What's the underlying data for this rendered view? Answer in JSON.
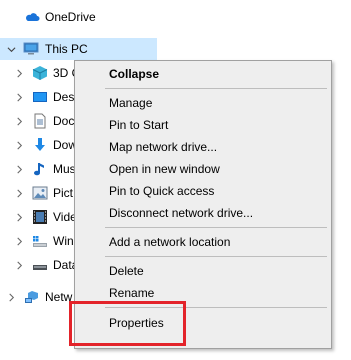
{
  "tree": {
    "items": [
      {
        "label": "OneDrive",
        "icon": "onedrive-cloud-icon"
      },
      {
        "label": "This PC",
        "icon": "computer-icon"
      },
      {
        "label": "3D O",
        "icon": "3d-objects-icon"
      },
      {
        "label": "Des",
        "icon": "desktop-icon"
      },
      {
        "label": "Doc",
        "icon": "documents-icon"
      },
      {
        "label": "Dow",
        "icon": "downloads-icon"
      },
      {
        "label": "Mus",
        "icon": "music-icon"
      },
      {
        "label": "Pict",
        "icon": "pictures-icon"
      },
      {
        "label": "Vide",
        "icon": "videos-icon"
      },
      {
        "label": "Win",
        "icon": "windows-drive-icon"
      },
      {
        "label": "Data",
        "icon": "data-drive-icon"
      },
      {
        "label": "Netw",
        "icon": "network-icon"
      }
    ]
  },
  "context_menu": {
    "items": [
      {
        "label": "Collapse",
        "bold": true
      },
      {
        "label": "Manage"
      },
      {
        "label": "Pin to Start"
      },
      {
        "label": "Map network drive..."
      },
      {
        "label": "Open in new window"
      },
      {
        "label": "Pin to Quick access"
      },
      {
        "label": "Disconnect network drive..."
      },
      {
        "label": "Add a network location"
      },
      {
        "label": "Delete"
      },
      {
        "label": "Rename"
      },
      {
        "label": "Properties"
      }
    ]
  },
  "colors": {
    "selection": "#cce8ff",
    "menu_background": "#eeeeee",
    "highlight_border": "#e3232a"
  }
}
